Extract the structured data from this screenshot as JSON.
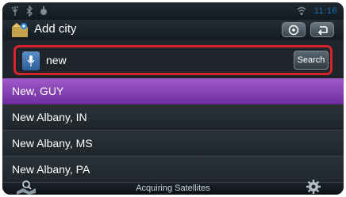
{
  "status_bar": {
    "clock": "11:16",
    "icons": [
      "usb-icon",
      "bluetooth-icon",
      "notification-icon",
      "wifi-signal-icon"
    ]
  },
  "header": {
    "title": "Add city",
    "app_icon": "add-city-icon",
    "buttons": [
      "compass-icon",
      "back-arrow-icon"
    ]
  },
  "search": {
    "value": "new",
    "button_label": "Search",
    "highlight_color": "#d2252b"
  },
  "results": [
    {
      "label": "New, GUY",
      "selected": true
    },
    {
      "label": "New Albany, IN",
      "selected": false
    },
    {
      "label": "New Albany, MS",
      "selected": false
    },
    {
      "label": "New Albany, PA",
      "selected": false
    }
  ],
  "footer": {
    "status_text": "Acquiring Satellites",
    "left_icon": "map-search-icon",
    "right_icon": "settings-gear-icon"
  },
  "colors": {
    "selected_row": "#8a47b8",
    "accent_blue": "#1a6fb8",
    "background": "#0e1418"
  }
}
